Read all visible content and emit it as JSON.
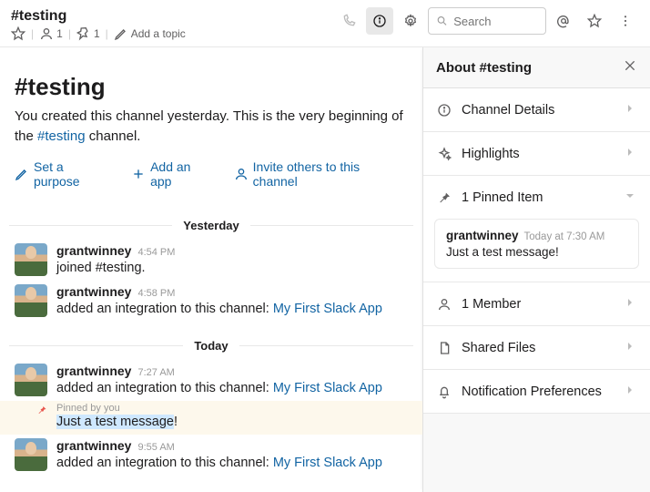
{
  "header": {
    "channel_name": "#testing",
    "members": "1",
    "pins": "1",
    "add_topic": "Add a topic",
    "search_placeholder": "Search"
  },
  "intro": {
    "title": "#testing",
    "line1_a": "You created this channel yesterday. This is the very beginning of the ",
    "line1_link": "#testing",
    "line1_b": " channel.",
    "set_purpose": "Set a purpose",
    "add_app": "Add an app",
    "invite": "Invite others to this channel"
  },
  "dividers": {
    "yesterday": "Yesterday",
    "today": "Today"
  },
  "messages": {
    "m1": {
      "user": "grantwinney",
      "time": "4:54 PM",
      "text": "joined #testing."
    },
    "m2": {
      "user": "grantwinney",
      "time": "4:58 PM",
      "text_a": "added an integration to this channel: ",
      "link": "My First Slack App"
    },
    "m3": {
      "user": "grantwinney",
      "time": "7:27 AM",
      "text_a": "added an integration to this channel: ",
      "link": "My First Slack App"
    },
    "pin": {
      "label": "Pinned by you",
      "text_hl": "Just a test message",
      "text_tail": "!"
    },
    "m4": {
      "user": "grantwinney",
      "time": "9:55 AM",
      "text_a": "added an integration to this channel: ",
      "link": "My First Slack App"
    }
  },
  "panel": {
    "title": "About #testing",
    "details": "Channel Details",
    "highlights": "Highlights",
    "pinned": "1 Pinned Item",
    "pin_user": "grantwinney",
    "pin_time": "Today at 7:30 AM",
    "pin_text": "Just a test message!",
    "members": "1 Member",
    "files": "Shared Files",
    "notif": "Notification Preferences"
  }
}
